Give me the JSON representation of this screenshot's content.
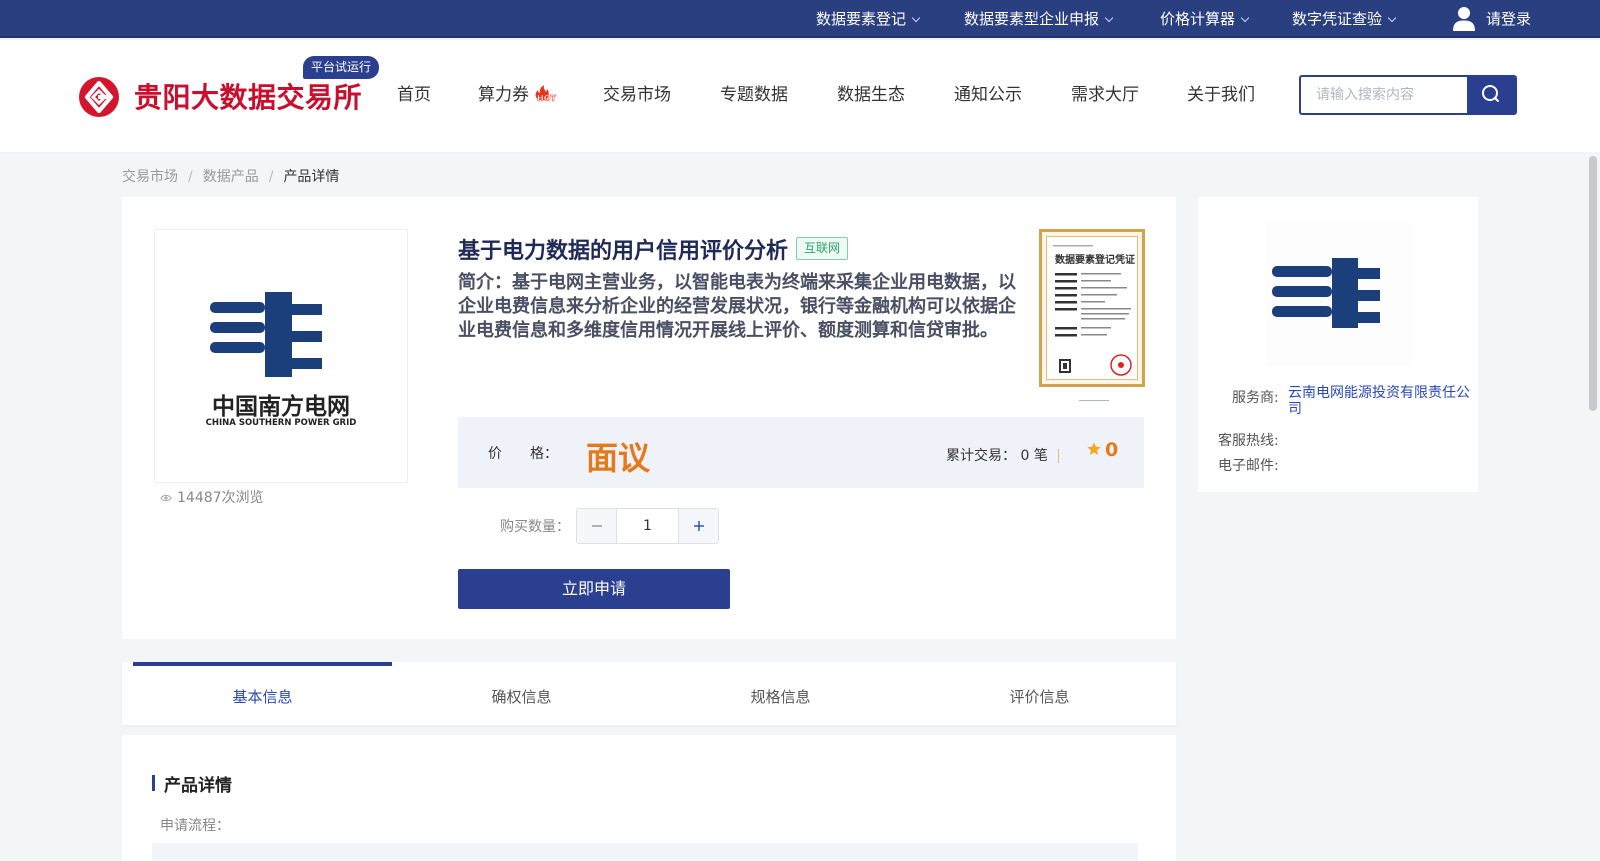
{
  "topbar": {
    "links": [
      {
        "label": "数据要素登记"
      },
      {
        "label": "数据要素型企业申报"
      },
      {
        "label": "价格计算器"
      },
      {
        "label": "数字凭证查验"
      }
    ],
    "login_label": "请登录"
  },
  "header": {
    "site_name": "贵阳大数据交易所",
    "trial_badge": "平台试运行",
    "nav": [
      {
        "label": "首页"
      },
      {
        "label": "算力券",
        "badge": "HOT"
      },
      {
        "label": "交易市场"
      },
      {
        "label": "专题数据"
      },
      {
        "label": "数据生态"
      },
      {
        "label": "通知公示"
      },
      {
        "label": "需求大厅"
      },
      {
        "label": "关于我们"
      }
    ],
    "search": {
      "placeholder": "请输入搜索内容",
      "value": ""
    }
  },
  "breadcrumb": [
    {
      "label": "交易市场"
    },
    {
      "label": "数据产品"
    },
    {
      "label": "产品详情"
    }
  ],
  "breadcrumb_sep": "/",
  "product": {
    "title": "基于电力数据的用户信用评价分析",
    "tag": "互联网",
    "intro": "简介：基于电网主营业务，以智能电表为终端来采集企业用电数据，以企业电费信息来分析企业的经营发展状况，银行等金融机构可以依据企业电费信息和多维度信用情况开展线上评价、额度测算和信贷审批。",
    "views": "14487次浏览",
    "logo_cn": "中国南方电网",
    "logo_en": "CHINA SOUTHERN POWER GRID",
    "certificate_title": "数据要素登记凭证",
    "price_label": "价　　格：",
    "price_value": "面议",
    "trade_label": "累计交易：",
    "trade_count": "0",
    "trade_unit": "笔",
    "rating": "0",
    "quantity_label": "购买数量：",
    "quantity": "1",
    "apply_label": "立即申请"
  },
  "provider": {
    "service_label": "服务商:",
    "service_value": "云南电网能源投资有限责任公司",
    "hotline_label": "客服热线:",
    "hotline_value": "",
    "email_label": "电子邮件:",
    "email_value": ""
  },
  "tabs": [
    {
      "label": "基本信息",
      "active": true
    },
    {
      "label": "确权信息",
      "active": false
    },
    {
      "label": "规格信息",
      "active": false
    },
    {
      "label": "评价信息",
      "active": false
    }
  ],
  "detail": {
    "section_title": "产品详情",
    "flow_label": "申请流程："
  },
  "colors": {
    "brand_navy": "#2a3f8f",
    "logo_red": "#c8102e",
    "price_orange": "#e57a1a",
    "link_blue": "#2a49b5",
    "grid_blue": "#1b3f7a"
  },
  "icons": {
    "user": "user-icon",
    "search": "search-icon",
    "eye": "eye-icon",
    "star": "star-icon",
    "chevron": "chevron-down-icon"
  }
}
